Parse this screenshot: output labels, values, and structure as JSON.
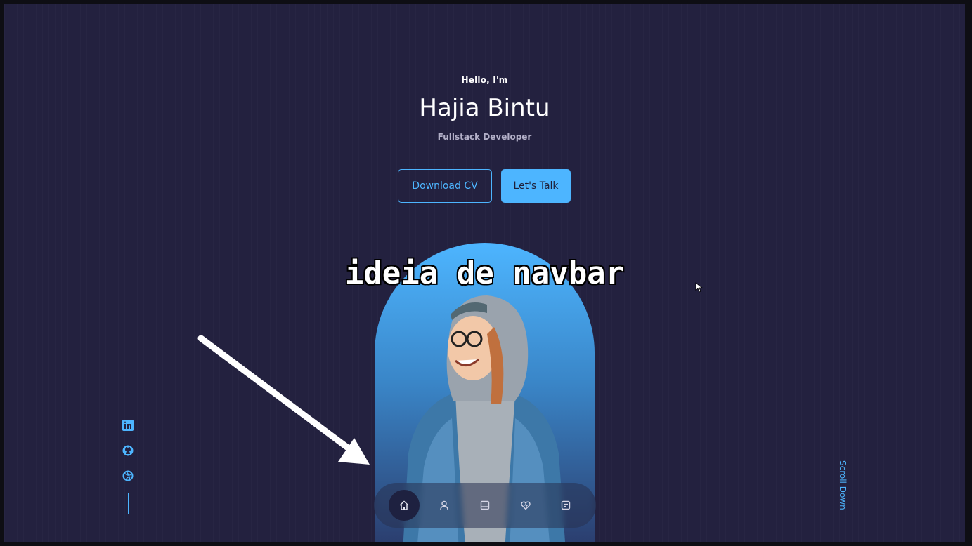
{
  "header": {
    "greeting": "Hello, I'm",
    "name": "Hajia Bintu",
    "role": "Fullstack Developer"
  },
  "actions": {
    "download_cv": "Download CV",
    "lets_talk": "Let's Talk"
  },
  "overlay": {
    "caption": "ideia de navbar"
  },
  "socials": [
    {
      "icon": "linkedin-icon"
    },
    {
      "icon": "github-icon"
    },
    {
      "icon": "dribbble-icon"
    }
  ],
  "scroll": {
    "label": "Scroll Down"
  },
  "navbar": {
    "items": [
      {
        "icon": "home-icon",
        "active": true
      },
      {
        "icon": "user-icon",
        "active": false
      },
      {
        "icon": "book-icon",
        "active": false
      },
      {
        "icon": "services-icon",
        "active": false
      },
      {
        "icon": "message-icon",
        "active": false
      }
    ]
  },
  "colors": {
    "background": "#23213f",
    "accent": "#4db5ff",
    "text": "#ffffff",
    "muted": "#b3b0c8"
  }
}
